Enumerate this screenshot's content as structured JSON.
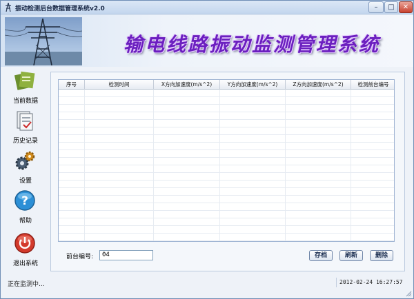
{
  "window": {
    "title": "振动检测后台数据管理系统v2.0",
    "controls": {
      "minimize": "–",
      "maximize": "□",
      "close": "✕"
    }
  },
  "banner": {
    "title": "输电线路振动监测管理系统"
  },
  "sidebar": {
    "items": [
      {
        "label": "当前数据",
        "icon": "current-data-icon"
      },
      {
        "label": "历史记录",
        "icon": "history-icon"
      },
      {
        "label": "设置",
        "icon": "settings-gear-icon"
      },
      {
        "label": "帮助",
        "icon": "help-icon"
      },
      {
        "label": "退出系统",
        "icon": "power-icon"
      }
    ]
  },
  "table": {
    "columns": [
      "序号",
      "检测时间",
      "X方向加速度(m/s^2)",
      "Y方向加速度(m/s^2)",
      "Z方向加速度(m/s^2)",
      "检测前台编号"
    ],
    "rows": []
  },
  "form": {
    "station_label": "前台编号:",
    "station_value": "04"
  },
  "actions": {
    "save": "存档",
    "refresh": "刷新",
    "delete": "删除"
  },
  "status": {
    "left": "正在监测中...",
    "datetime": "2012-02-24 16:27:57"
  },
  "colors": {
    "title_purple": "#6b1fbf",
    "close_red": "#c8412f"
  }
}
